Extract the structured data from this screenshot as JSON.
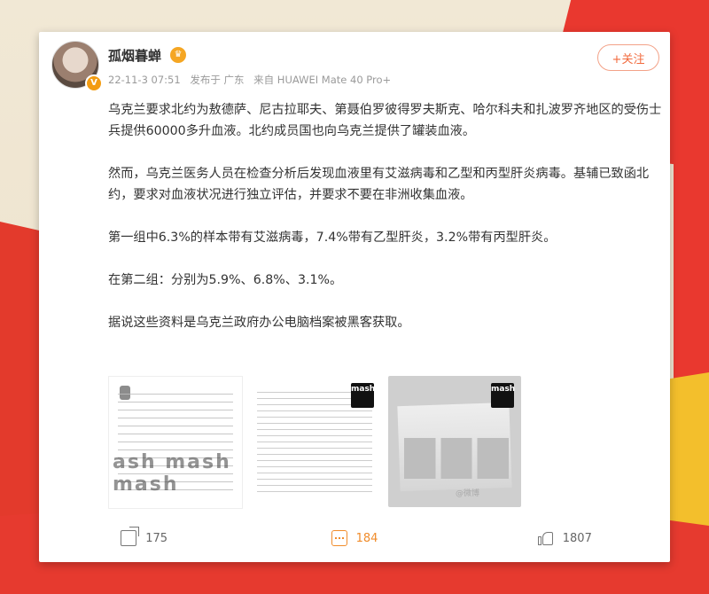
{
  "post": {
    "username": "孤烟暮蝉",
    "verified_badge": "V",
    "crown_badge": "♛",
    "timestamp": "22-11-3 07:51",
    "location": "发布于 广东",
    "device": "来自 HUAWEI Mate 40 Pro+",
    "follow_label": "+关注",
    "paragraphs": [
      "乌克兰要求北约为敖德萨、尼古拉耶夫、第聂伯罗彼得罗夫斯克、哈尔科夫和扎波罗齐地区的受伤士兵提供60000多升血液。北约成员国也向乌克兰提供了罐装血液。",
      "然而，乌克兰医务人员在检查分析后发现血液里有艾滋病毒和乙型和丙型肝炎病毒。基辅已致函北约，要求对血液状况进行独立评估，并要求不要在非洲收集血液。",
      "第一组中6.3%的样本带有艾滋病毒，7.4%带有乙型肝炎，3.2%带有丙型肝炎。",
      "在第二组：分别为5.9%、6.8%、3.1%。",
      "据说这些资料是乌克兰政府办公电脑档案被黑客获取。"
    ]
  },
  "images": {
    "watermark": "ash mash mash",
    "logo_text": "mash",
    "weibo_mark": "@微博"
  },
  "actions": {
    "share_count": "175",
    "comment_count": "184",
    "like_count": "1807"
  },
  "colors": {
    "accent": "#f26a3d",
    "comment_active": "#f08c2b"
  },
  "icons": [
    "share-icon",
    "comment-icon",
    "like-icon",
    "crown-icon"
  ]
}
